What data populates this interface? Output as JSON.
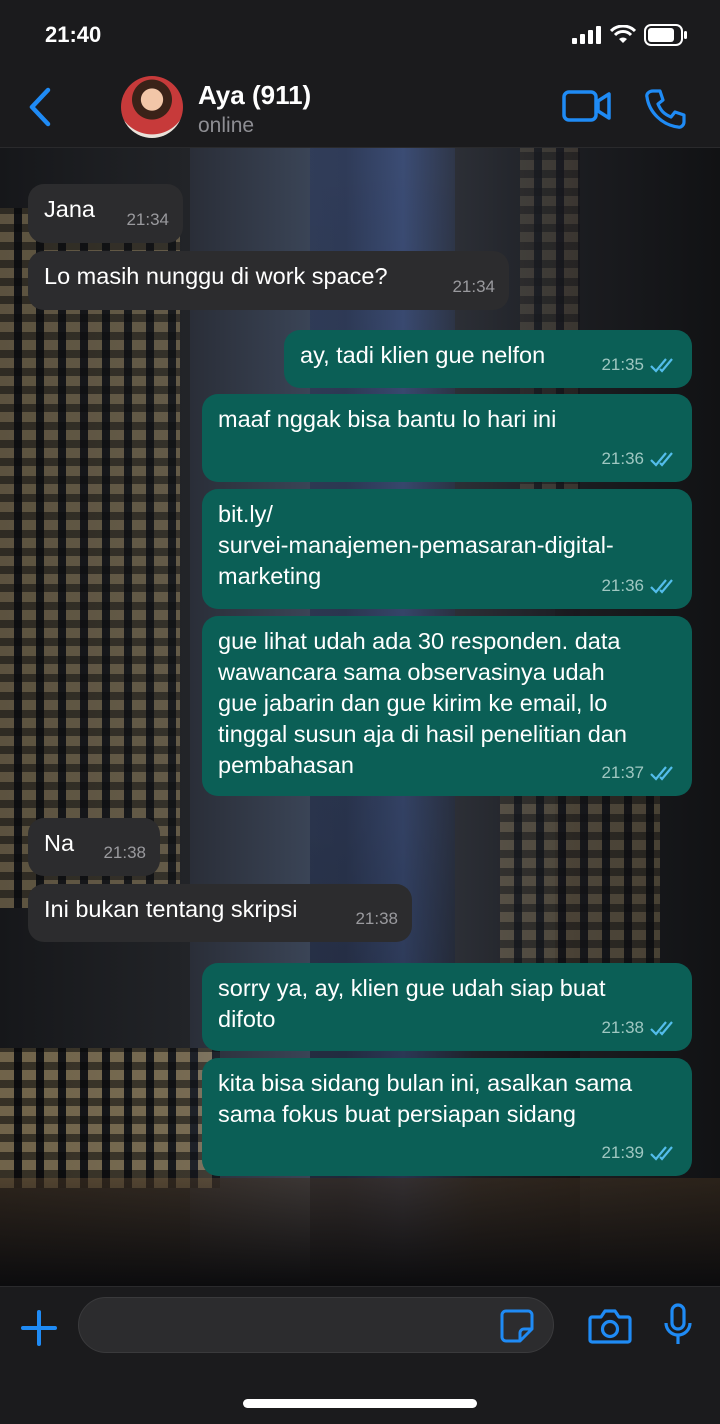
{
  "status_bar": {
    "time": "21:40"
  },
  "header": {
    "name": "Aya (911)",
    "status": "online"
  },
  "messages": [
    {
      "dir": "in",
      "text": "Jana",
      "time": "21:34"
    },
    {
      "dir": "in",
      "text": "Lo masih nunggu di work space?",
      "time": "21:34"
    },
    {
      "dir": "out",
      "text": "ay, tadi klien gue nelfon",
      "time": "21:35"
    },
    {
      "dir": "out",
      "text": "maaf nggak bisa bantu lo hari ini",
      "time": "21:36"
    },
    {
      "dir": "out",
      "text": "bit.ly/\nsurvei-manajemen-pemasaran-digital-\nmarketing",
      "time": "21:36"
    },
    {
      "dir": "out",
      "text": "gue lihat udah ada 30 responden. data\nwawancara sama observasinya udah\ngue jabarin dan gue kirim ke email, lo\ntinggal susun aja di hasil penelitian dan\npembahasan",
      "time": "21:37"
    },
    {
      "dir": "in",
      "text": "Na",
      "time": "21:38"
    },
    {
      "dir": "in",
      "text": "Ini bukan tentang skripsi",
      "time": "21:38"
    },
    {
      "dir": "out",
      "text": "sorry ya, ay, klien gue udah siap buat\ndifoto",
      "time": "21:38"
    },
    {
      "dir": "out",
      "text": "kita bisa sidang bulan ini, asalkan sama\nsama fokus buat persiapan sidang",
      "time": "21:39"
    }
  ],
  "input": {
    "placeholder": "",
    "value": ""
  },
  "colors": {
    "accent": "#1f8bf5",
    "outgoing": "#0b5f56",
    "incoming": "#2c2c2e",
    "read_tick": "#53bdeb"
  },
  "icons": [
    "back-icon",
    "video-call-icon",
    "phone-icon",
    "plus-icon",
    "sticker-icon",
    "camera-icon",
    "mic-icon",
    "double-check-icon"
  ]
}
